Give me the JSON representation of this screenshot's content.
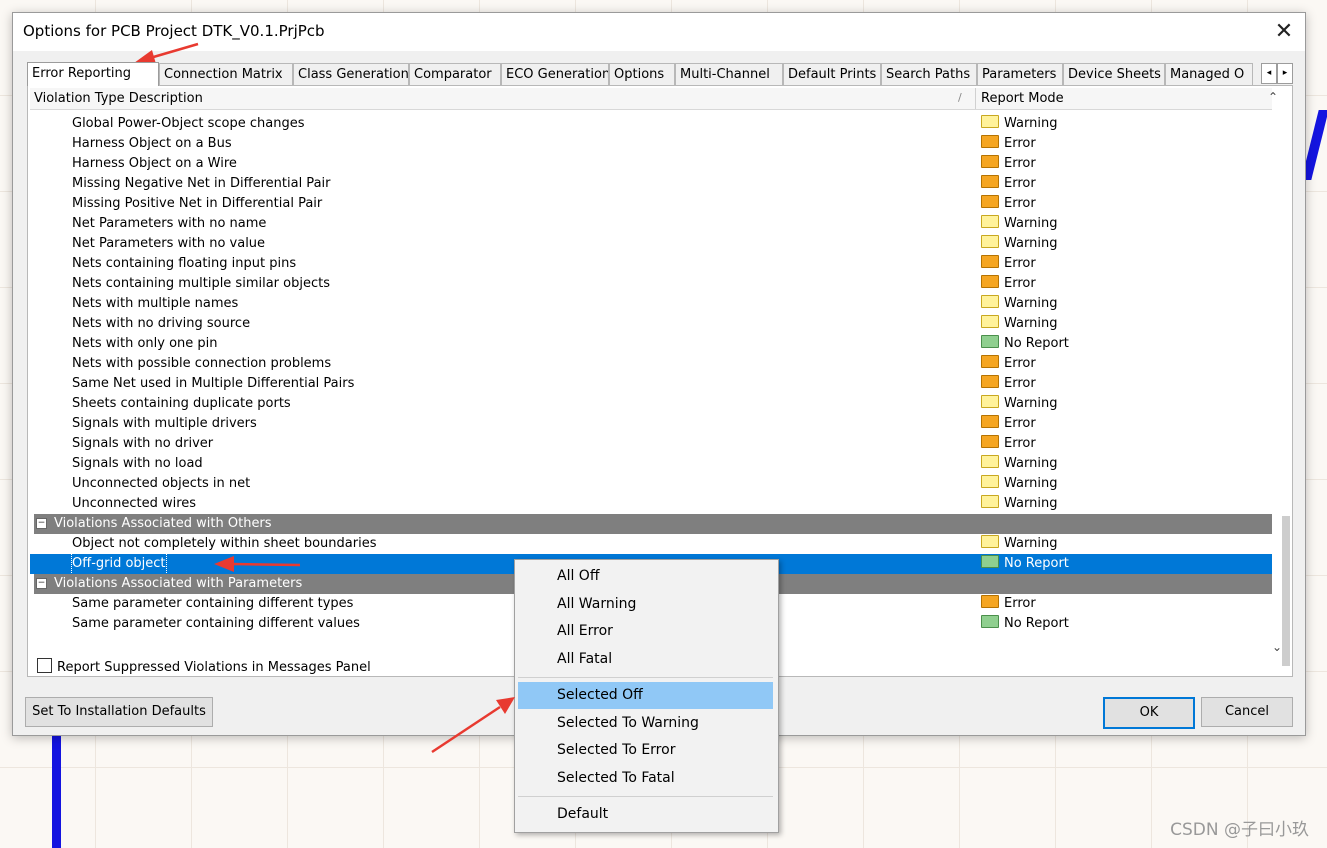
{
  "dialog": {
    "title": "Options for PCB Project DTK_V0.1.PrjPcb",
    "close_glyph": "✕"
  },
  "tabs": [
    {
      "label": "Error Reporting",
      "active": true
    },
    {
      "label": "Connection Matrix"
    },
    {
      "label": "Class Generation"
    },
    {
      "label": "Comparator"
    },
    {
      "label": "ECO Generation"
    },
    {
      "label": "Options"
    },
    {
      "label": "Multi-Channel"
    },
    {
      "label": "Default Prints"
    },
    {
      "label": "Search Paths"
    },
    {
      "label": "Parameters"
    },
    {
      "label": "Device Sheets"
    },
    {
      "label": "Managed O"
    }
  ],
  "table": {
    "col_description": "Violation Type Description",
    "col_report_mode": "Report Mode",
    "sort_glyph": "/",
    "rows": [
      {
        "name": "Global Power-Object scope changes",
        "mode": "Warning"
      },
      {
        "name": "Harness Object on a Bus",
        "mode": "Error"
      },
      {
        "name": "Harness Object on a Wire",
        "mode": "Error"
      },
      {
        "name": "Missing Negative Net in Differential Pair",
        "mode": "Error"
      },
      {
        "name": "Missing Positive Net in Differential Pair",
        "mode": "Error"
      },
      {
        "name": "Net Parameters with no name",
        "mode": "Warning"
      },
      {
        "name": "Net Parameters with no value",
        "mode": "Warning"
      },
      {
        "name": "Nets containing floating input pins",
        "mode": "Error"
      },
      {
        "name": "Nets containing multiple similar objects",
        "mode": "Error"
      },
      {
        "name": "Nets with multiple names",
        "mode": "Warning"
      },
      {
        "name": "Nets with no driving source",
        "mode": "Warning"
      },
      {
        "name": "Nets with only one pin",
        "mode": "No Report"
      },
      {
        "name": "Nets with possible connection problems",
        "mode": "Error"
      },
      {
        "name": "Same Net used in Multiple Differential Pairs",
        "mode": "Error"
      },
      {
        "name": "Sheets containing duplicate ports",
        "mode": "Warning"
      },
      {
        "name": "Signals with multiple drivers",
        "mode": "Error"
      },
      {
        "name": "Signals with no driver",
        "mode": "Error"
      },
      {
        "name": "Signals with no load",
        "mode": "Warning"
      },
      {
        "name": "Unconnected objects in net",
        "mode": "Warning"
      },
      {
        "name": "Unconnected wires",
        "mode": "Warning"
      },
      {
        "group": true,
        "name": "Violations Associated with Others"
      },
      {
        "name": "Object not completely within sheet boundaries",
        "mode": "Warning"
      },
      {
        "name": "Off-grid object",
        "mode": "No Report",
        "selected": true
      },
      {
        "group": true,
        "name": "Violations Associated with Parameters"
      },
      {
        "name": "Same parameter containing different types",
        "mode": "Error"
      },
      {
        "name": "Same parameter containing different values",
        "mode": "No Report"
      }
    ]
  },
  "checkbox_label": "Report Suppressed Violations in Messages Panel",
  "buttons": {
    "defaults": "Set To Installation Defaults",
    "ok": "OK",
    "cancel": "Cancel"
  },
  "context_menu": [
    {
      "label": "All Off"
    },
    {
      "label": "All Warning"
    },
    {
      "label": "All Error"
    },
    {
      "label": "All Fatal"
    },
    {
      "separator": true
    },
    {
      "label": "Selected Off",
      "highlighted": true
    },
    {
      "label": "Selected To Warning"
    },
    {
      "label": "Selected To Error"
    },
    {
      "label": "Selected To Fatal"
    },
    {
      "separator": true
    },
    {
      "label": "Default"
    }
  ],
  "watermark": "CSDN @子曰小玖",
  "colors": {
    "selection": "#0078d7",
    "group_header": "#7f7f7f",
    "menu_highlight": "#90c8f6",
    "annotation_arrow": "#e83a30"
  }
}
